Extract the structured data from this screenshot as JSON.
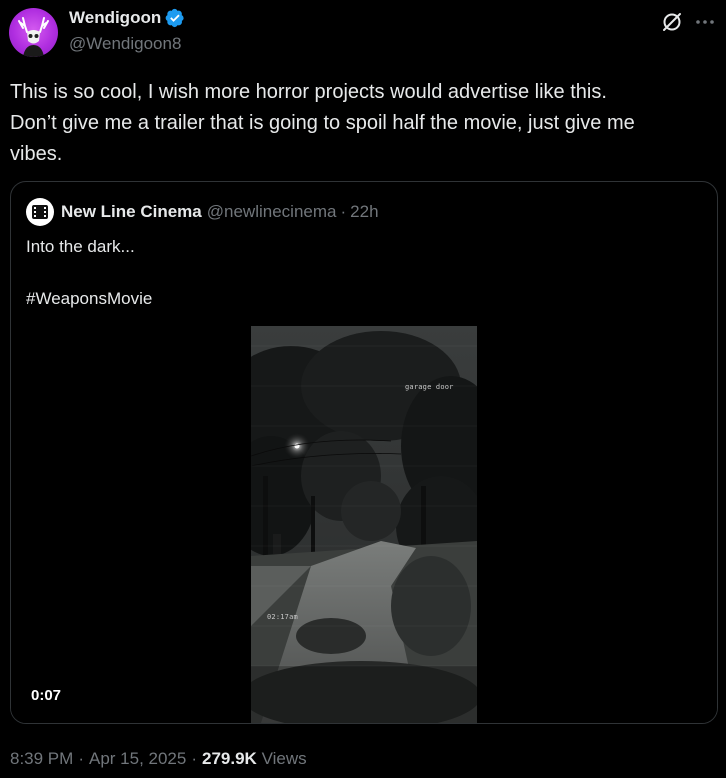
{
  "author": {
    "name": "Wendigoon",
    "handle": "@Wendigoon8",
    "verified": true,
    "avatar_icon": "deer-skull-avatar",
    "avatar_color": "#b02ee0",
    "badge_color": "#1d9bf0"
  },
  "actions": {
    "grok_icon": "grok-icon",
    "more_icon": "more-options-icon"
  },
  "tweet": {
    "text": "This is so cool, I wish more horror projects would advertise like this.\nDon’t give me a trailer that is going to spoil half the movie, just give me\nvibes."
  },
  "quote": {
    "author_name": "New Line Cinema",
    "author_handle": "@newlinecinema",
    "separator": "·",
    "time": "22h",
    "text": "Into the dark...\n\n#WeaponsMovie",
    "video": {
      "overlay_top": "garage door",
      "overlay_bottom": "02:17am",
      "duration": "0:07"
    }
  },
  "meta": {
    "time": "8:39 PM",
    "sep1": "·",
    "date": "Apr 15, 2025",
    "sep2": "·",
    "views_count": "279.9K",
    "views_label": "Views"
  }
}
